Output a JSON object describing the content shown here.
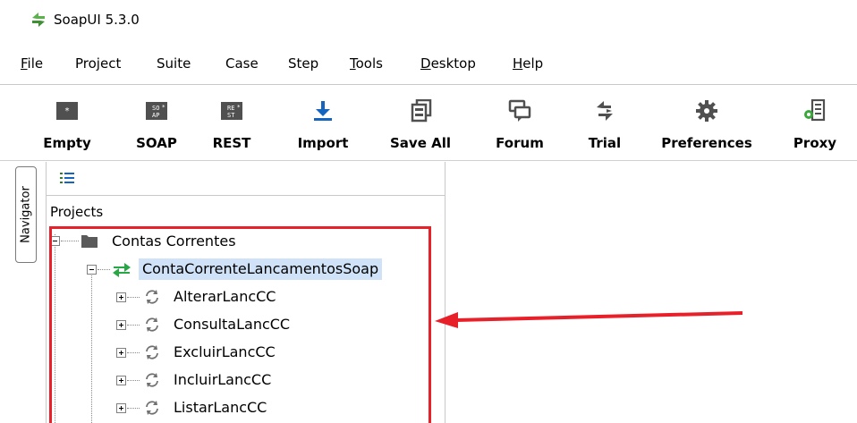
{
  "window": {
    "title": "SoapUI 5.3.0"
  },
  "menu": [
    {
      "label": "File",
      "underline": "F",
      "rest": "ile"
    },
    {
      "label": "Project",
      "underline": "",
      "rest": "Project"
    },
    {
      "label": "Suite",
      "underline": "",
      "rest": "Suite"
    },
    {
      "label": "Case",
      "underline": "",
      "rest": "Case"
    },
    {
      "label": "Step",
      "underline": "",
      "rest": "Step"
    },
    {
      "label": "Tools",
      "underline": "T",
      "rest": "ools"
    },
    {
      "label": "Desktop",
      "underline": "D",
      "rest": "esktop"
    },
    {
      "label": "Help",
      "underline": "H",
      "rest": "elp"
    }
  ],
  "toolbar": {
    "empty": "Empty",
    "soap": "SOAP",
    "rest": "REST",
    "import": "Import",
    "save_all": "Save All",
    "forum": "Forum",
    "trial": "Trial",
    "preferences": "Preferences",
    "proxy": "Proxy",
    "soap_icon_text": "SO AP",
    "rest_icon_text": "RE ST"
  },
  "navigator": {
    "tab_label": "Navigator",
    "projects_label": "Projects",
    "project": "Contas Correntes",
    "interface": "ContaCorrenteLancamentosSoap",
    "operations": [
      "AlterarLancCC",
      "ConsultaLancCC",
      "ExcluirLancCC",
      "IncluirLancCC",
      "ListarLancCC"
    ]
  },
  "colors": {
    "highlight": "#e8202a",
    "selection": "#cfe2f7",
    "soapui_green": "#4caf50",
    "icon_gray": "#555555",
    "import_blue": "#1565c0"
  }
}
